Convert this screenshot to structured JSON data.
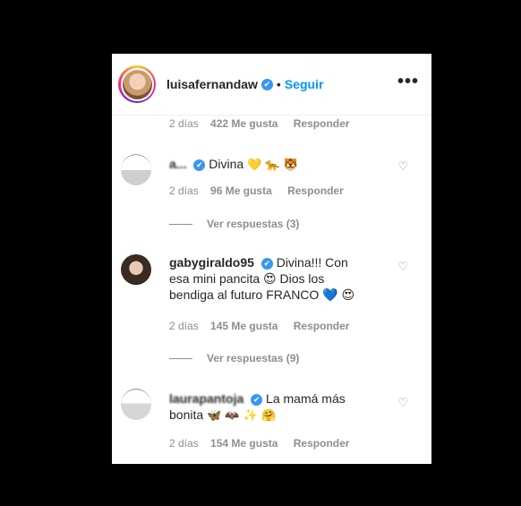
{
  "header": {
    "username": "luisafernandaw",
    "separator": "•",
    "follow_label": "Seguir",
    "more_label": "•••"
  },
  "top_meta": {
    "time": "2 días",
    "likes": "422 Me gusta",
    "reply": "Responder"
  },
  "comments": [
    {
      "username": "a...",
      "text": "Divina",
      "emojis": "💛 🐆 🐯",
      "time": "2 días",
      "likes": "96 Me gusta",
      "reply": "Responder",
      "view_replies": "Ver respuestas (3)"
    },
    {
      "username": "gabygiraldo95",
      "text": "Divina!!! Con esa mini pancita 😍 Dios los bendiga al futuro FRANCO 💙 😍",
      "time": "2 días",
      "likes": "145 Me gusta",
      "reply": "Responder",
      "view_replies": "Ver respuestas (9)"
    },
    {
      "username": "laurapantoja",
      "text": "La mamá más bonita",
      "emojis": "🦋 🦇 ✨ 🤗",
      "time": "2 días",
      "likes": "154 Me gusta",
      "reply": "Responder"
    }
  ],
  "icons": {
    "verified": "✔",
    "heart": "♡"
  },
  "colors": {
    "accent": "#0095f6",
    "verified": "#3897f0",
    "muted": "#8e8e8e",
    "background": "#000000"
  }
}
